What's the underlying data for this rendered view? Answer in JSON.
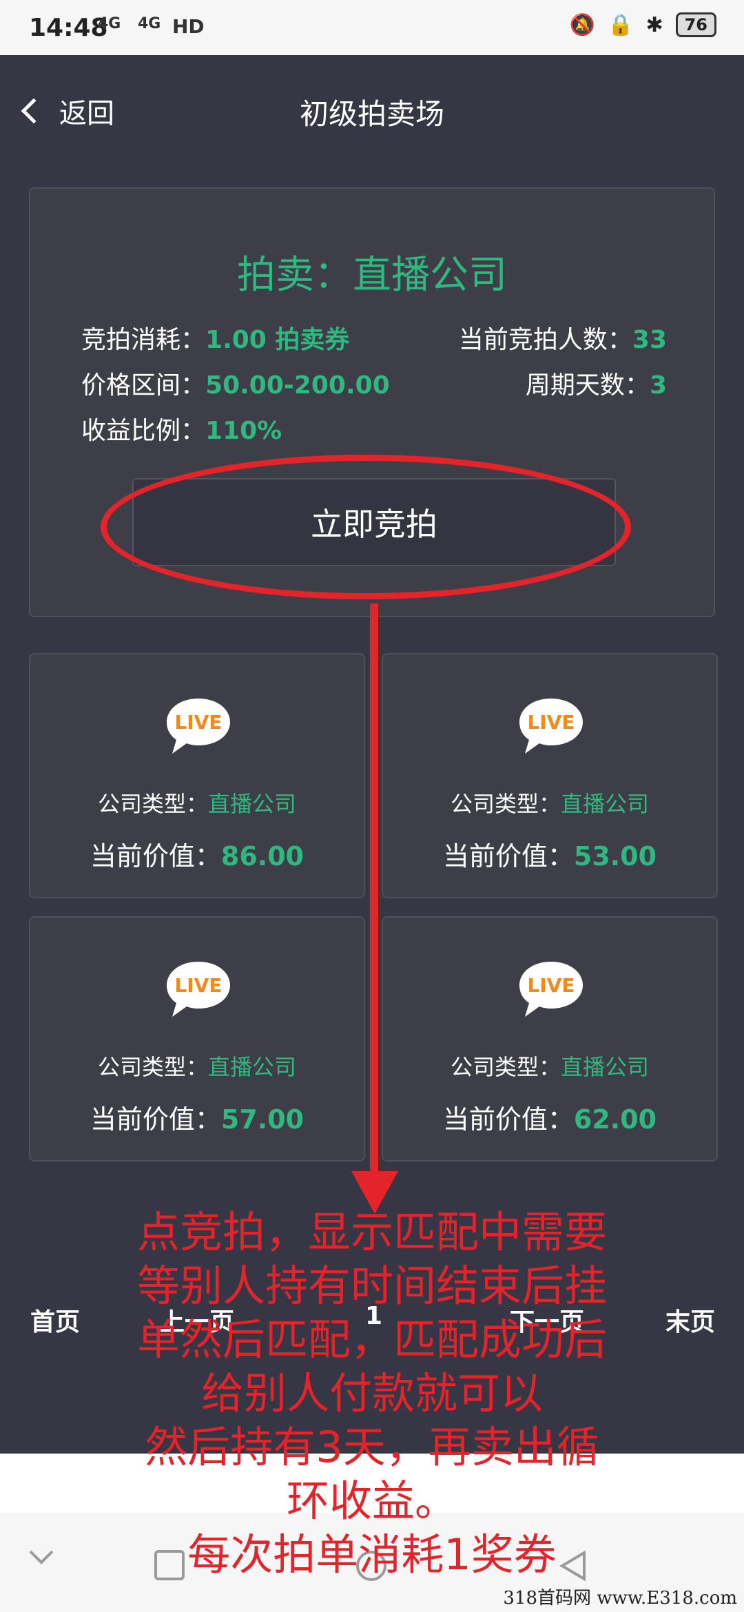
{
  "status_bar": {
    "time": "14:48",
    "signal1": "4G",
    "signal2": "4G",
    "hd": "HD",
    "battery": "76"
  },
  "header": {
    "back_label": "返回",
    "title": "初级拍卖场"
  },
  "auction": {
    "title": "拍卖：直播公司",
    "cost_label": "竞拍消耗：",
    "cost_value": "1.00 拍卖券",
    "bidders_label": "当前竞拍人数：",
    "bidders_value": "33",
    "price_label": "价格区间：",
    "price_value": "50.00-200.00",
    "period_label": "周期天数：",
    "period_value": "3",
    "ratio_label": "收益比例：",
    "ratio_value": "110%",
    "bid_button": "立即竞拍"
  },
  "items": [
    {
      "icon": "live-icon",
      "type_label": "公司类型：",
      "type_value": "直播公司",
      "value_label": "当前价值：",
      "value": "86.00"
    },
    {
      "icon": "live-icon",
      "type_label": "公司类型：",
      "type_value": "直播公司",
      "value_label": "当前价值：",
      "value": "53.00"
    },
    {
      "icon": "live-icon",
      "type_label": "公司类型：",
      "type_value": "直播公司",
      "value_label": "当前价值：",
      "value": "57.00"
    },
    {
      "icon": "live-icon",
      "type_label": "公司类型：",
      "type_value": "直播公司",
      "value_label": "当前价值：",
      "value": "62.00"
    }
  ],
  "pager": {
    "first": "首页",
    "prev": "上一页",
    "current": "1",
    "next": "下一页",
    "last": "末页"
  },
  "annotation": {
    "lines": [
      "点竞拍，显示匹配中需要",
      "等别人持有时间结束后挂",
      "单然后匹配，匹配成功后",
      "给别人付款就可以",
      "然后持有3天，再卖出循",
      "环收益。",
      "每次拍单消耗1奖券"
    ],
    "color": "#e3242b"
  },
  "watermark": "318首码网 www.E318.com",
  "colors": {
    "accent": "#2fb980",
    "background": "#373644",
    "card": "#3e3e49"
  }
}
